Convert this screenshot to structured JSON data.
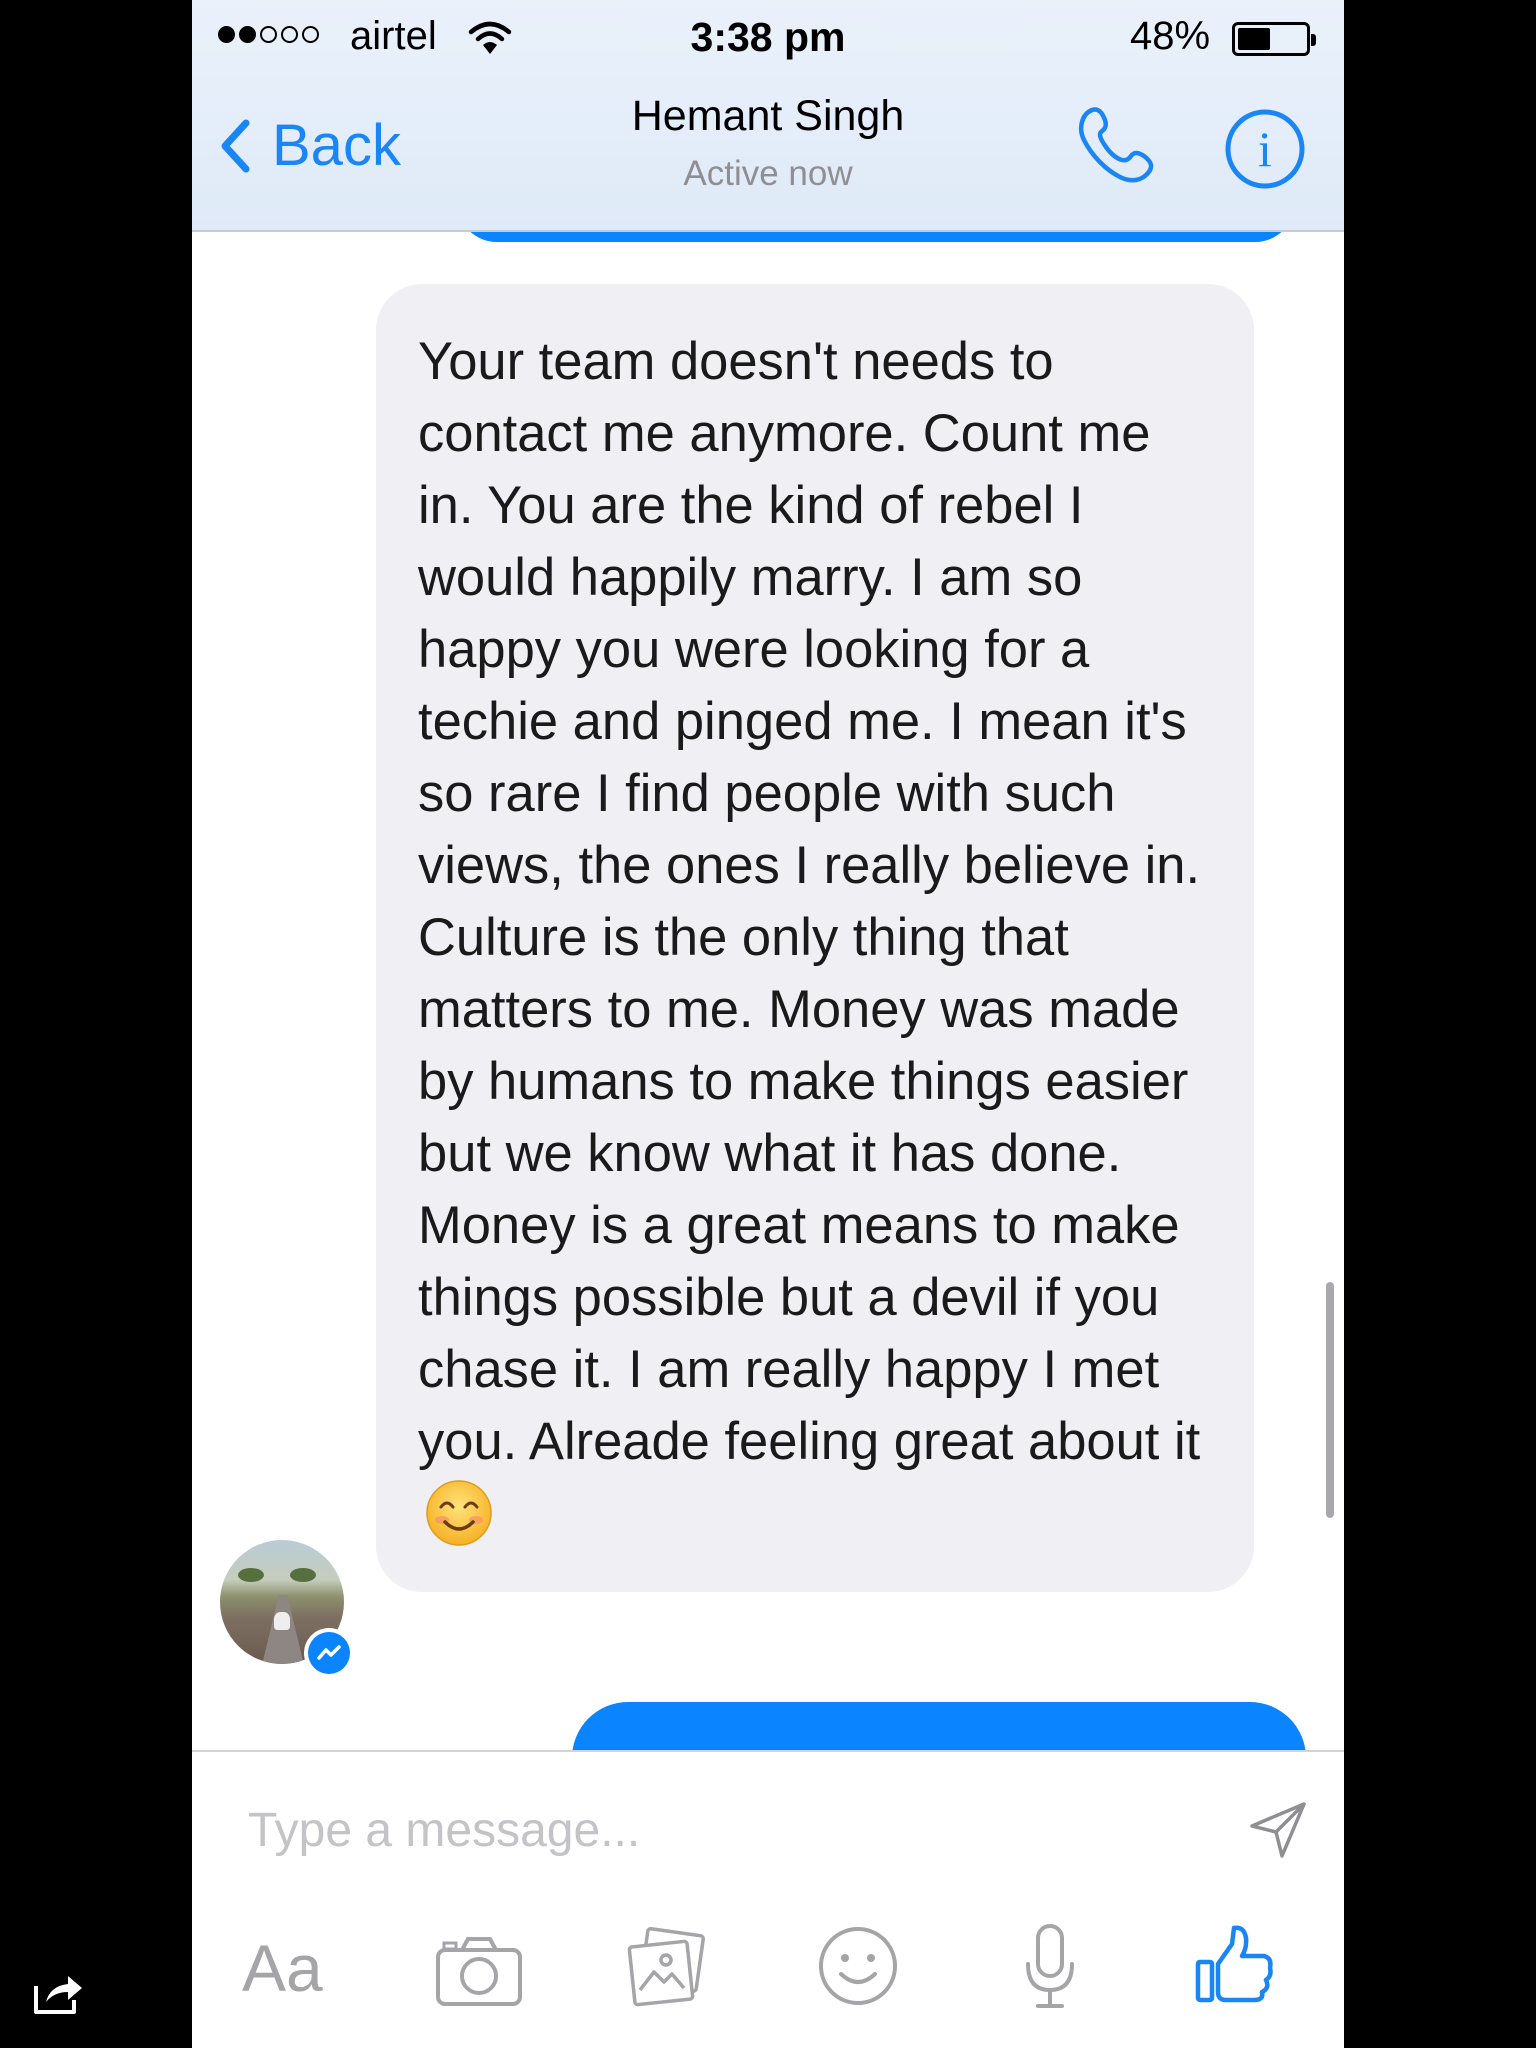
{
  "status_bar": {
    "carrier": "airtel",
    "time": "3:38 pm",
    "battery": "48%",
    "battery_level": 0.48,
    "signal_bars_filled": 2,
    "signal_bars_total": 5
  },
  "header": {
    "back_label": "Back",
    "contact_name": "Hemant Singh",
    "contact_status": "Active now"
  },
  "messages": [
    {
      "direction": "incoming",
      "text": "Your team doesn't needs to contact me anymore. Count me in. You are the kind of rebel I would happily marry. I am so happy you were looking for a techie and pinged me. I mean it's so rare I find people with such views, the ones I really believe in. Culture is the only thing that matters to me. Money was made by humans to make things easier but we know what it has done. Money is a great means to make things possible but a devil if you chase it. I am really happy I met you. Alreade feeling great about it",
      "emoji": "smiling-face-icon"
    }
  ],
  "composer": {
    "placeholder": "Type a message...",
    "aa_label": "Aa"
  },
  "colors": {
    "accent": "#0b84ff",
    "incoming_bubble": "#efeff4",
    "header_bg": "#e5eef9",
    "icon_gray": "#a4a4a9"
  },
  "icons": {
    "back": "chevron-left-icon",
    "call": "phone-icon",
    "info": "info-icon",
    "send": "send-icon",
    "camera": "camera-icon",
    "gallery": "gallery-icon",
    "emoji": "emoji-icon",
    "mic": "microphone-icon",
    "like": "thumbs-up-icon",
    "share": "share-icon"
  }
}
